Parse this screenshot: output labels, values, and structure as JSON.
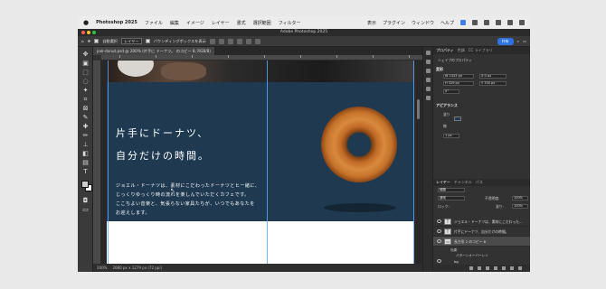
{
  "menubar": {
    "app_name": "Photoshop 2025",
    "menus": [
      "ファイル",
      "編集",
      "イメージ",
      "レイヤー",
      "書式",
      "選択範囲",
      "フィルター"
    ],
    "right_items": [
      "表示",
      "プラグイン",
      "ウィンドウ",
      "ヘルプ"
    ]
  },
  "window": {
    "title": "Adobe Photoshop 2025"
  },
  "options_bar": {
    "auto_select_label": "自動選択",
    "layer_dropdown": "レイヤー",
    "bounding_box_label": "バウンディングボックスを表示",
    "share_label": "共有"
  },
  "document": {
    "tab_label": "joel-donut.psd @ 200% (片手に ドーナツ。 のコピー 8, RGB/8)",
    "zoom": "200%",
    "doc_size": "2080 px x 1279 px (72 ppi)"
  },
  "artwork": {
    "headline_1": "片手にドーナツ、",
    "headline_2": "自分だけの時間。",
    "body_1": "ジョエル・ドーナツは、素材にこだわったドーナツとヒー緒に、",
    "body_2": "じっくりゆっくり時の流れを楽しんでいただくカフェです。",
    "body_3": "ここちよい音楽と、気張らない家具たちが、いつでもあなたを",
    "body_4": "お迎えします。"
  },
  "properties": {
    "tabs": [
      "プロパティ",
      "色調",
      "CC ライブラリ"
    ],
    "type_label": "シェイプのプロパティ",
    "transform_label": "変形",
    "w": "W 1443 px",
    "x": "X 0 px",
    "h": "H 329 px",
    "y": "Y 700 px",
    "angle": "0°",
    "appearance_label": "アピアランス",
    "fill_label": "塗り",
    "stroke_label": "線",
    "stroke_width": "1 px"
  },
  "layers": {
    "tabs": [
      "レイヤー",
      "チャンネル",
      "パス"
    ],
    "search_label": "種類",
    "blend_mode": "通常",
    "opacity_label": "不透明度:",
    "opacity_value": "100%",
    "lock_label": "ロック:",
    "fill_label": "塗り:",
    "fill_value": "100%",
    "items": [
      {
        "thumb": "T",
        "name": "ジョエル・ドーナツは、素材にこだわった..."
      },
      {
        "thumb": "T",
        "name": "片手にドーナツ、自分だけの時間。"
      },
      {
        "thumb": "▭",
        "name": "長方形 2 のコピー 8"
      },
      {
        "thumb": "▭",
        "name": "長方形 2"
      }
    ],
    "effects": [
      "効果",
      "パターンオーバーレイ"
    ],
    "group_name": "bg"
  },
  "colors": {
    "artboard_blue": "#1f3a50",
    "accent": "#2d72e0",
    "guide": "#5aa6ff"
  }
}
